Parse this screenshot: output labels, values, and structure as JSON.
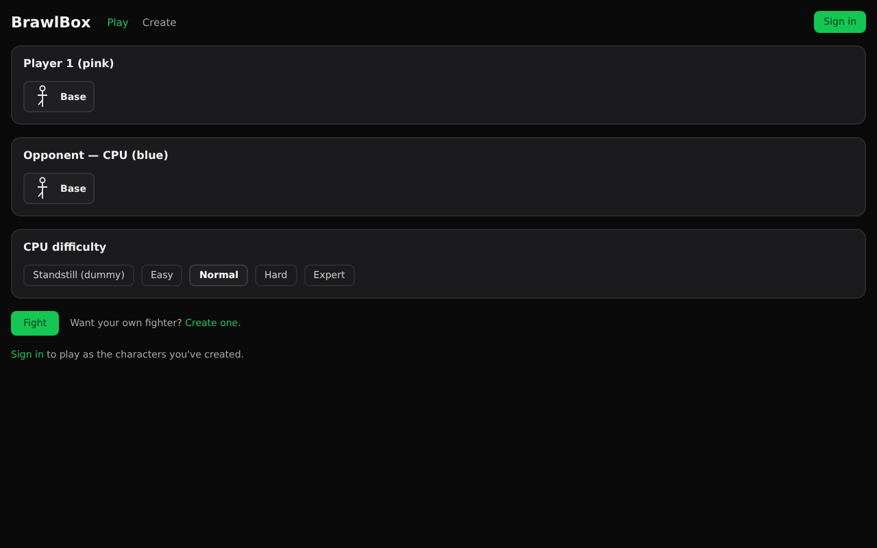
{
  "header": {
    "brand": "BrawlBox",
    "nav": [
      {
        "label": "Play",
        "selected": true
      },
      {
        "label": "Create",
        "selected": false
      }
    ],
    "sign_in": "Sign in"
  },
  "slots": [
    {
      "title": "Player 1 (pink)",
      "fighters": [
        {
          "name": "Base"
        }
      ]
    },
    {
      "title": "Opponent — CPU (blue)",
      "fighters": [
        {
          "name": "Base"
        }
      ]
    }
  ],
  "difficulty": {
    "title": "CPU difficulty",
    "options": [
      {
        "label": "Standstill (dummy)",
        "selected": false
      },
      {
        "label": "Easy",
        "selected": false
      },
      {
        "label": "Normal",
        "selected": true
      },
      {
        "label": "Hard",
        "selected": false
      },
      {
        "label": "Expert",
        "selected": false
      }
    ]
  },
  "fight_button": "Fight",
  "create_prompt": {
    "text": "Want your own fighter?",
    "link": "Create one",
    "suffix": "."
  },
  "signin_prompt": {
    "link": "Sign in",
    "text": "to play as the characters you've created."
  }
}
